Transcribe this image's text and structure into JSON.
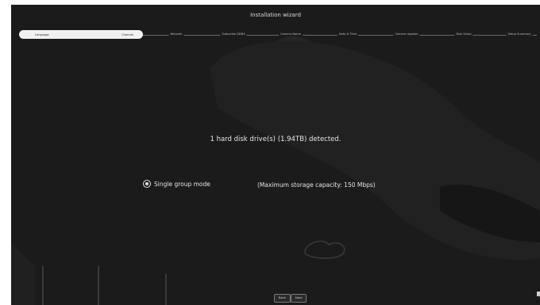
{
  "wizard": {
    "title": "Installation wizard",
    "steps": [
      {
        "label": "Language",
        "active": true
      },
      {
        "label": "Channel",
        "active": true
      },
      {
        "label": "Network",
        "active": false
      },
      {
        "label": "Subscribe DDNS",
        "active": false
      },
      {
        "label": "Camera Name",
        "active": false
      },
      {
        "label": "Date & Time",
        "active": false
      },
      {
        "label": "Camera register",
        "active": false
      },
      {
        "label": "Disk Setup",
        "active": false
      },
      {
        "label": "Setup Summary",
        "active": false
      }
    ]
  },
  "main": {
    "detected_text": "1 hard disk drive(s) (1.94TB) detected.",
    "mode_option": {
      "label": "Single group mode",
      "selected": true
    },
    "capacity_text": "(Maximum storage capacity: 150 Mbps)"
  },
  "footer": {
    "back_label": "Back",
    "next_label": "Next"
  },
  "colors": {
    "background": "#1b1b1b",
    "text": "#e6e6e6",
    "active_step": "#f1f1f1"
  }
}
